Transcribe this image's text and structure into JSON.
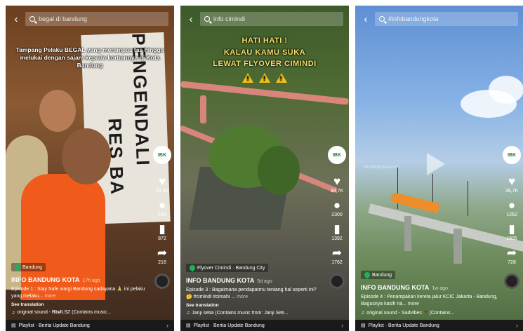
{
  "panels": [
    {
      "search": "begal di bandung",
      "overlay": "Tampang Pelaku BEGAL yang merampas tas hingga melukai dengan sajam kepada korbannya di Kota Bandung",
      "banner_text": [
        "PENGENDALI",
        "RES BA"
      ],
      "likes": "29,4K",
      "comments": "548",
      "saves": "872",
      "shares": "216",
      "location": "Bandung",
      "author": "INFO BANDUNG KOTA",
      "ago": "17h ago",
      "caption": "Episode 1 : Stay Safe wargi Bandung sadayana 🙏 ini pelaku yang melaku...",
      "more": "more",
      "translation": "See translation",
      "sound": "original sound - 𝐑𝐢𝐬𝐟𝐢.SZ (Contains music...",
      "playlist": "Playlist · Berita Update Bandung"
    },
    {
      "search": "info cimindi",
      "overlay_lines": [
        "HATI HATI !",
        "KALAU KAMU SUKA",
        "LEWAT FLYOVER CIMINDI"
      ],
      "likes": "34,7K",
      "comments": "2300",
      "saves": "1392",
      "shares": "1762",
      "location": "Flyover Cimindi · Bandung City",
      "author": "INFO BANDUNG KOTA",
      "ago": "5d ago",
      "caption": "Episode 3 : Bagaimana pendapatmu tentang hal seperti ini? 🤔 #cimindi #cimahi ...",
      "more": "more",
      "translation": "See translation",
      "sound": "Janji setia (Contains music from: Janji Seti...",
      "playlist": "Playlist · Berita Update Bandung"
    },
    {
      "search": "#infobandungkota",
      "watermark": "INFOBANDUNGKOTA",
      "likes": "38,7K",
      "comments": "1262",
      "saves": "1805",
      "shares": "728",
      "location": "Bandung",
      "author": "INFO BANDUNG KOTA",
      "ago": "1w ago",
      "caption": "Episode 4 : Penampakan kereta jalur KCIC Jakarta - Bandung, Bagusnya kasih na... more",
      "more": "",
      "translation": "",
      "sound": "original sound - Sadvibes🥀 (Contains...",
      "playlist": "Playlist · Berita Update Bandung"
    }
  ],
  "avatar_text": "IBK",
  "icons": {
    "back": "back-arrow-icon",
    "search": "search-icon",
    "like": "heart-icon",
    "comment": "comment-icon",
    "save": "bookmark-icon",
    "share": "share-icon",
    "location": "location-pin-icon",
    "sound": "music-note-icon",
    "playlist": "playlist-icon"
  },
  "colors": {
    "location_pin": "#1bb35a",
    "overlay_yellow": "#f4e06a",
    "warning": "#f2c318"
  }
}
